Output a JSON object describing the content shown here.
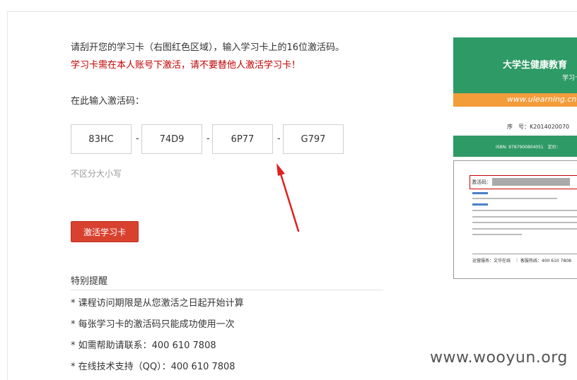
{
  "instructions": "请刮开您的学习卡（右图红色区域），输入学习卡上的16位激活码。",
  "warning": "学习卡需在本人账号下激活，请不要替他人激活学习卡！",
  "prompt": "在此输入激活码：",
  "code_fields": [
    "83HC",
    "74D9",
    "6P77",
    "G797"
  ],
  "separator": "-",
  "case_hint": "不区分大小写",
  "activate_button": "激活学习卡",
  "tips_title": "特别提醒",
  "tips": [
    "* 课程访问期限是从您激活之日起开始计算",
    "* 每张学习卡的激活码只能成功使用一次",
    "* 如需帮助请联系：400 610 7808",
    "* 在线技术支持（QQ）：400 610 7808"
  ],
  "card": {
    "title": "大学生健康教育",
    "subtitle": "学习卡",
    "url": "www.ulearning.cn",
    "serial": "序　号：K2014020070",
    "isbn": "ISBN: 9787900804051　定价：",
    "code_label": "激活码：",
    "phone": "运营服务：文华在线　｜ 客服热线：400 610 7808",
    "colors": {
      "green": "#2e9a66",
      "orange": "#f29c3a",
      "red": "#cc0000"
    }
  },
  "arrow_color": "#e02020",
  "watermark": "www.wooyun.org"
}
